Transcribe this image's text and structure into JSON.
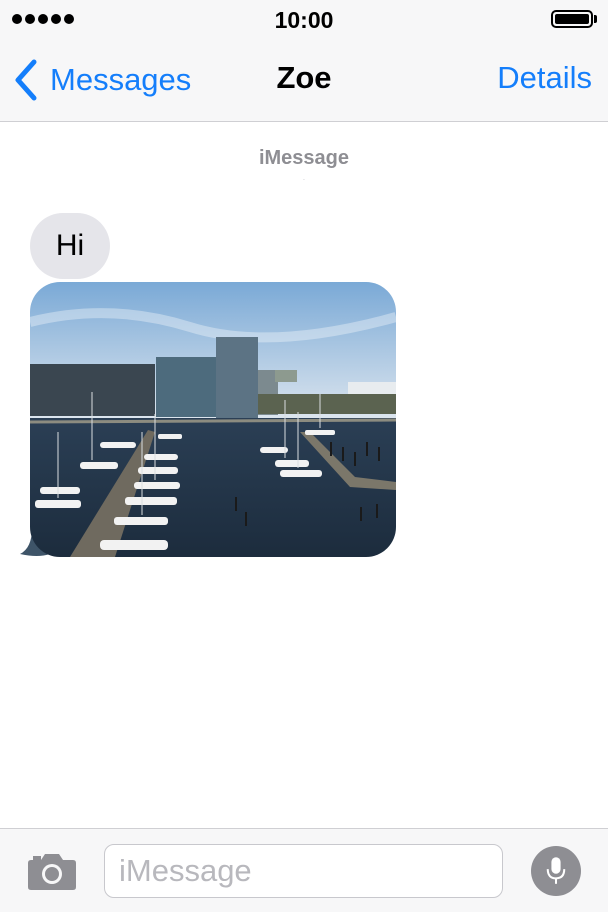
{
  "status_bar": {
    "signal_icon": "signal-dots-icon",
    "time": "10:00",
    "battery_icon": "battery-full-icon",
    "battery_level": 1.0
  },
  "nav": {
    "back_icon": "chevron-left-icon",
    "back_label": "Messages",
    "title": "Zoe",
    "details_label": "Details"
  },
  "conversation": {
    "service_label": "iMessage",
    "messages": [
      {
        "type": "text",
        "direction": "incoming",
        "text": "Hi"
      },
      {
        "type": "image",
        "direction": "incoming",
        "image_icon": "harbor-photo"
      }
    ]
  },
  "input_bar": {
    "camera_icon": "camera-icon",
    "placeholder": "iMessage",
    "value": "",
    "mic_icon": "microphone-icon"
  },
  "colors": {
    "accent": "#147efb",
    "incoming_bubble": "#e5e5ea",
    "bar_background": "#f7f7f8",
    "secondary_text": "#8e8e93"
  }
}
